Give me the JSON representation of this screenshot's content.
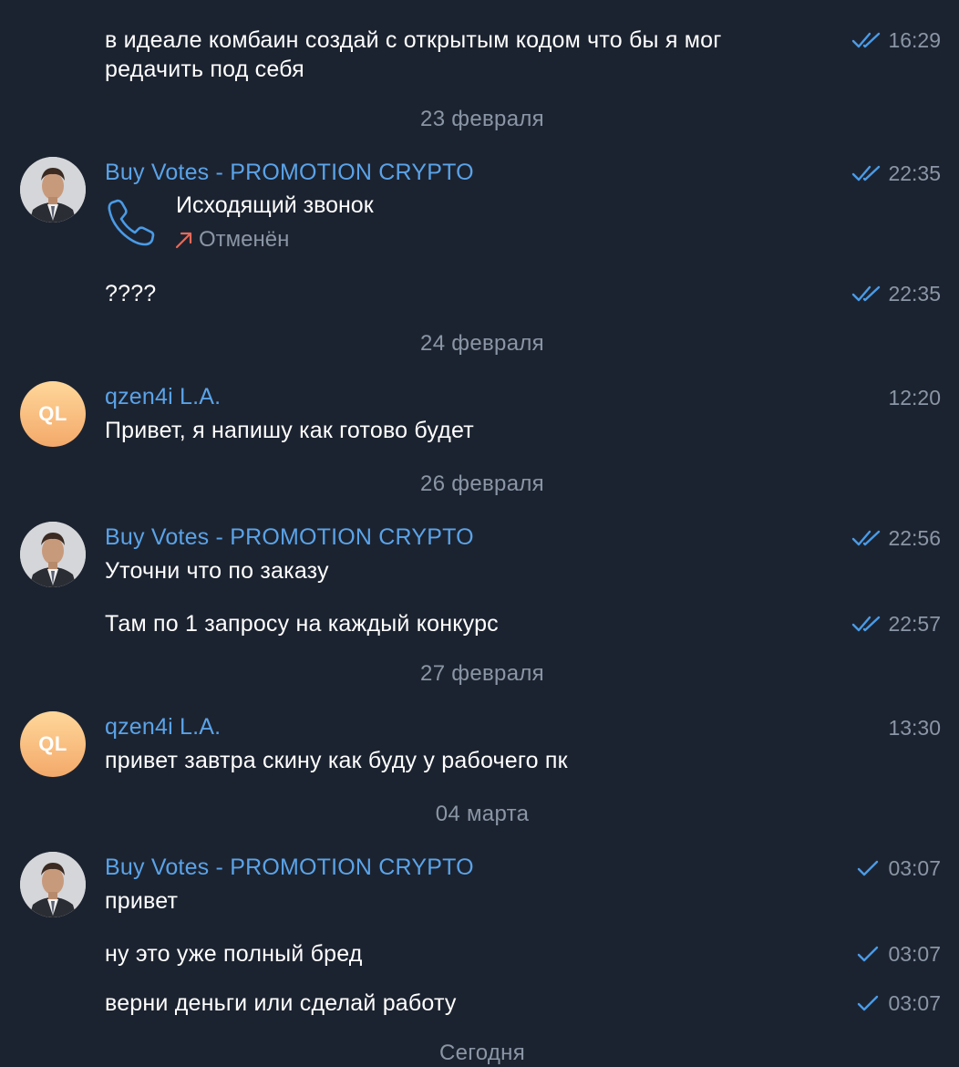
{
  "colors": {
    "background": "#1c2330",
    "accent_name": "#5aa3e8",
    "muted": "#8a96a5",
    "check": "#4a9be6",
    "missed_arrow": "#e66a5a"
  },
  "messages": {
    "m0": {
      "partial_top": "",
      "text_line1": "в идеале комбаин создай с открытым кодом что бы я мог",
      "text_line2": "редачить под себя",
      "time": "16:29",
      "check": "double-check-icon"
    },
    "d1": {
      "label": "23 февраля"
    },
    "m1": {
      "sender": "Buy Votes - PROMOTION CRYPTO",
      "time": "22:35",
      "call_title": "Исходящий звонок",
      "call_status": "Отменён"
    },
    "m2": {
      "text": "????",
      "time": "22:35"
    },
    "d2": {
      "label": "24 февраля"
    },
    "m3": {
      "sender": "qzen4i L.A.",
      "avatar_initials": "QL",
      "text": "Привет, я напишу как готово будет",
      "time": "12:20"
    },
    "d3": {
      "label": "26 февраля"
    },
    "m4": {
      "sender": "Buy Votes - PROMOTION CRYPTO",
      "text": "Уточни что по заказу",
      "time": "22:56"
    },
    "m5": {
      "text": "Там по 1 запросу на каждый конкурс",
      "time": "22:57"
    },
    "d4": {
      "label": "27 февраля"
    },
    "m6": {
      "sender": "qzen4i L.A.",
      "avatar_initials": "QL",
      "text": "привет завтра скину как буду у рабочего пк",
      "time": "13:30"
    },
    "d5": {
      "label": "04 марта"
    },
    "m7": {
      "sender": "Buy Votes - PROMOTION CRYPTO",
      "text": "привет",
      "time": "03:07"
    },
    "m8": {
      "text": "ну это уже полный бред",
      "time": "03:07"
    },
    "m9": {
      "text": "верни деньги или сделай работу",
      "time": "03:07"
    },
    "d6": {
      "label": "Сегодня"
    }
  }
}
